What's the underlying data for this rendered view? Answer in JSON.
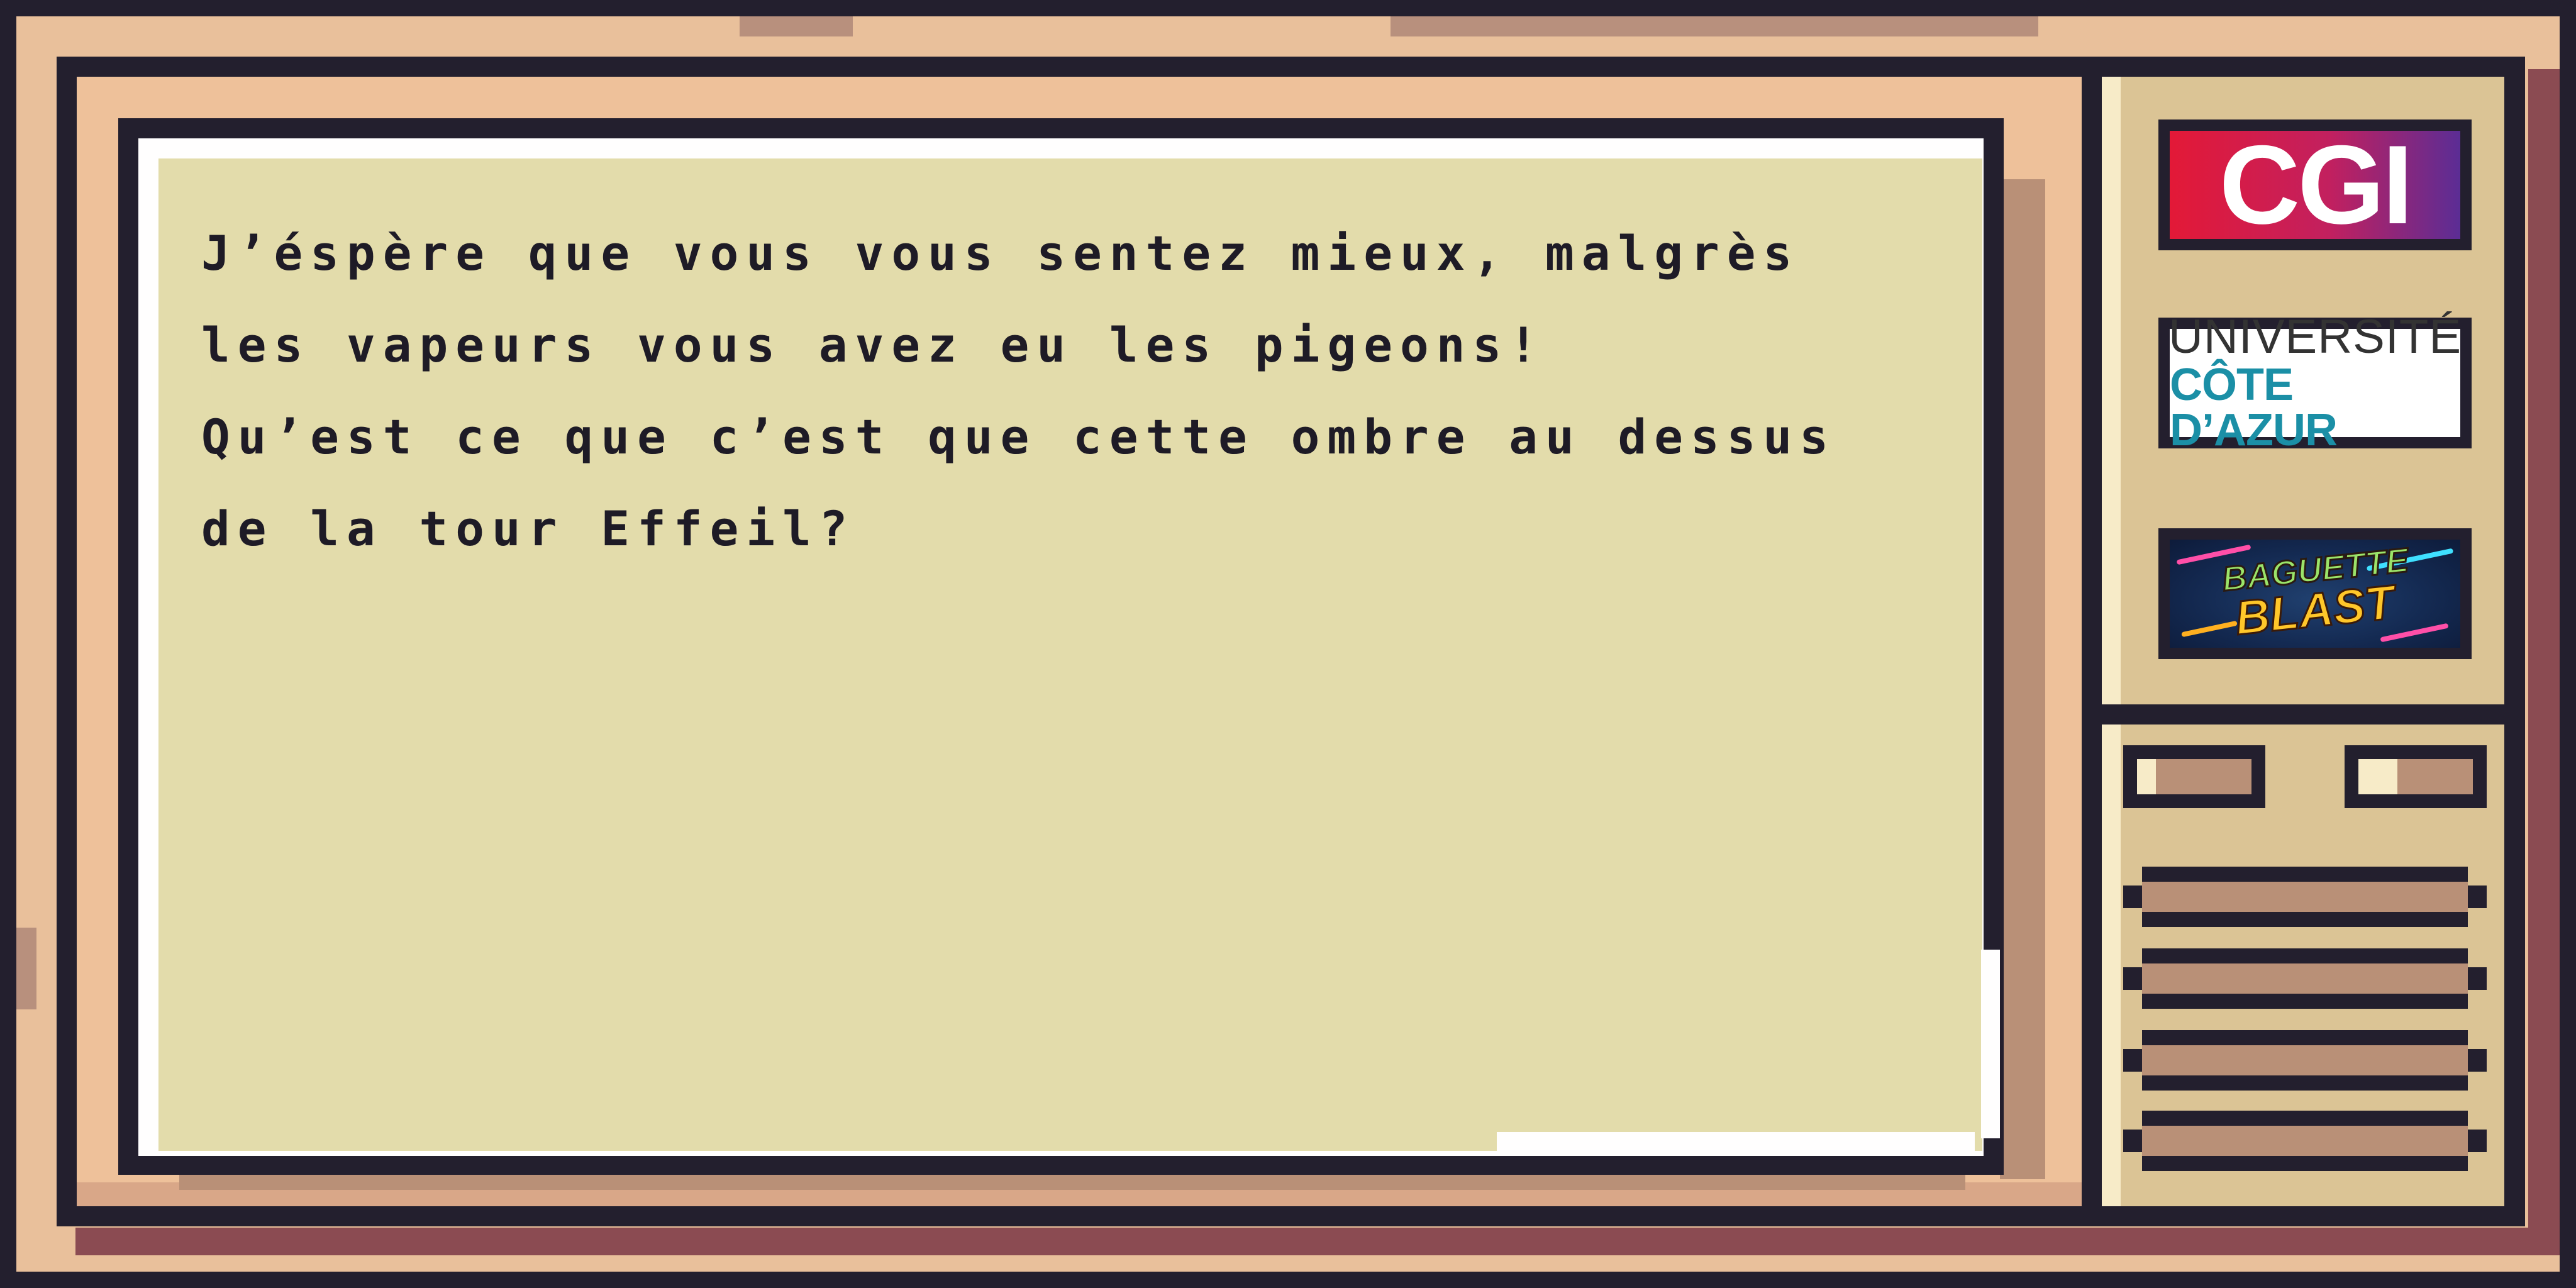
{
  "dialog": {
    "lines": [
      "J’éspère que vous vous sentez mieux, malgrès",
      "les vapeurs vous avez eu les pigeons!",
      "Qu’est ce que c’est que cette ombre au dessus",
      "de la tour Effeil?"
    ]
  },
  "side_panel": {
    "logos": [
      {
        "name": "CGI",
        "text": "CGI"
      },
      {
        "name": "Université Côte d'Azur",
        "line1": "UNIVERSITÉ",
        "line2": "CÔTE D’AZUR"
      },
      {
        "name": "Baguette Blast",
        "line1": "BAGUETTE",
        "line2": "BLAST"
      }
    ],
    "knobs": [
      "knob-left",
      "knob-right"
    ],
    "speaker_grille_bars": 4
  },
  "colors": {
    "screen_background": "#e3dcab",
    "bezel": "#e9c09b",
    "outline": "#231f2e",
    "side_panel": "#dbc495",
    "text": "#1e1b26"
  }
}
